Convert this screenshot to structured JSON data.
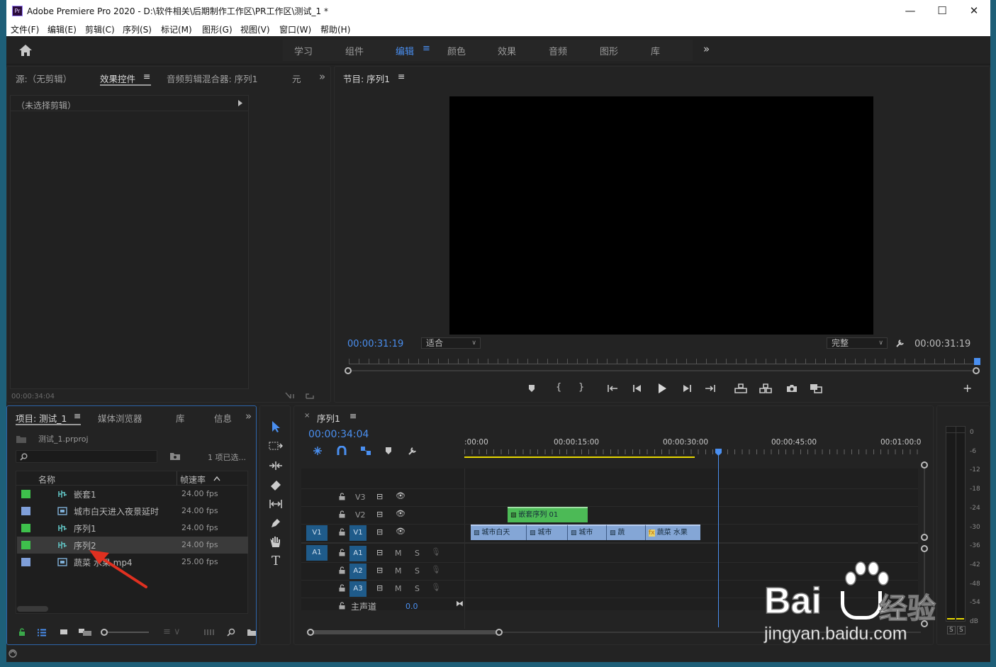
{
  "window": {
    "title": "Adobe Premiere Pro 2020 - D:\\软件相关\\后期制作工作区\\PR工作区\\测试_1 *",
    "logo_text": "Pr",
    "minimize": "—",
    "maximize": "☐",
    "close": "✕"
  },
  "menu": [
    "文件(F)",
    "编辑(E)",
    "剪辑(C)",
    "序列(S)",
    "标记(M)",
    "图形(G)",
    "视图(V)",
    "窗口(W)",
    "帮助(H)"
  ],
  "workspaces": {
    "tabs": [
      "学习",
      "组件",
      "编辑",
      "颜色",
      "效果",
      "音频",
      "图形",
      "库"
    ],
    "active": "编辑",
    "more": "»"
  },
  "source_panel": {
    "tabs": [
      "源:（无剪辑）",
      "效果控件",
      "音频剪辑混合器: 序列1",
      "元"
    ],
    "active_tab": "效果控件",
    "clip_label": "（未选择剪辑）",
    "timecode": "00:00:34:04"
  },
  "program_monitor": {
    "title": "节目: 序列1",
    "timecode_left": "00:00:31:19",
    "fit": "适合",
    "quality": "完整",
    "timecode_right": "00:00:31:19"
  },
  "project_panel": {
    "tabs": [
      "项目: 测试_1",
      "媒体浏览器",
      "库",
      "信息"
    ],
    "project_file": "测试_1.prproj",
    "search_placeholder": "",
    "selected_count": "1 项已选...",
    "columns": {
      "name": "名称",
      "fps": "帧速率"
    },
    "items": [
      {
        "name": "嵌套1",
        "fps": "24.00 fps",
        "color": "#3ec04c",
        "type": "sequence"
      },
      {
        "name": "城市白天进入夜景延时",
        "fps": "24.00 fps",
        "color": "#7f9fd9",
        "type": "clip"
      },
      {
        "name": "序列1",
        "fps": "24.00 fps",
        "color": "#3ec04c",
        "type": "sequence"
      },
      {
        "name": "序列2",
        "fps": "24.00 fps",
        "color": "#3ec04c",
        "type": "sequence"
      },
      {
        "name": "蔬菜 水果.mp4",
        "fps": "25.00 fps",
        "color": "#7f9fd9",
        "type": "clip"
      }
    ]
  },
  "timeline": {
    "sequence_tab": "序列1",
    "timecode": "00:00:34:04",
    "ruler": [
      ":00:00",
      "00:00:15:00",
      "00:00:30:00",
      "00:00:45:00",
      "00:01:00:0"
    ],
    "tracks": {
      "v3": "V3",
      "v2": "V2",
      "v1": "V1",
      "a1": "A1",
      "a2": "A2",
      "a3": "A3",
      "src_v1": "V1",
      "src_a1": "A1",
      "master": "主声道",
      "master_vol": "0.0",
      "m": "M",
      "s": "S"
    },
    "clips": {
      "v2": "嵌套序列 01",
      "v1": [
        "城市白天",
        "城市",
        "城市",
        "蔬",
        "蔬菜 水果"
      ],
      "fx": "fx"
    }
  },
  "meter": {
    "scale": [
      "0",
      "-6",
      "-12",
      "-18",
      "-24",
      "-30",
      "-36",
      "-42",
      "-48",
      "-54",
      "dB"
    ],
    "solo": "S"
  },
  "watermark": {
    "brand": "Bai",
    "cn": "经验",
    "url": "jingyan.baidu.com"
  }
}
